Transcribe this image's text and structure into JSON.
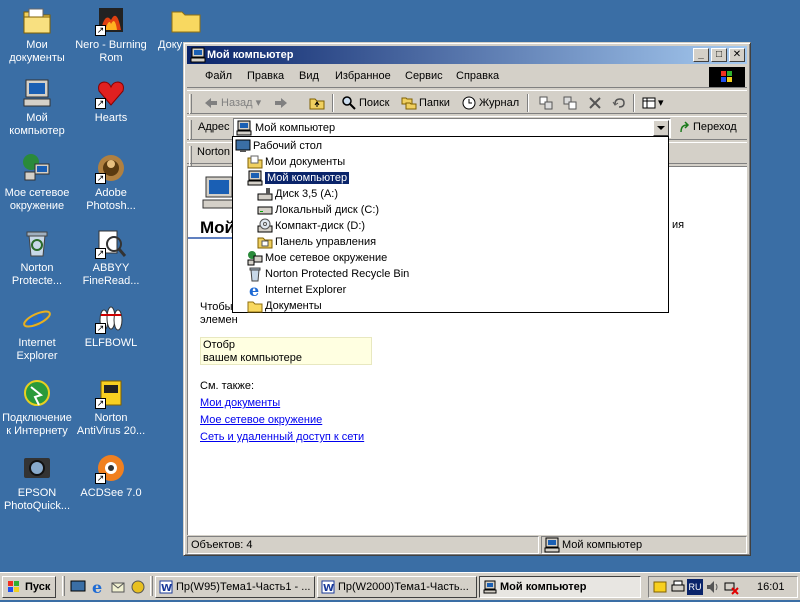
{
  "desktop": {
    "icons": [
      {
        "label": "Мои документы",
        "icon": "my-documents-icon"
      },
      {
        "label": "Nero - Burning Rom",
        "icon": "nero-icon"
      },
      {
        "label": "Доку",
        "icon": "folder-icon"
      },
      {
        "label": "Мой компьютер",
        "icon": "my-computer-icon"
      },
      {
        "label": "Hearts",
        "icon": "hearts-icon"
      },
      {
        "label": "Мое сетевое окружение",
        "icon": "network-icon"
      },
      {
        "label": "Adobe Photosh...",
        "icon": "photoshop-icon"
      },
      {
        "label": "Norton Protecte...",
        "icon": "recycle-bin-icon"
      },
      {
        "label": "ABBYY FineRead...",
        "icon": "abbyy-icon"
      },
      {
        "label": "Internet Explorer",
        "icon": "ie-icon"
      },
      {
        "label": "ELFBOWL",
        "icon": "elfbowl-icon"
      },
      {
        "label": "Подключение к Интернету",
        "icon": "connect-icon"
      },
      {
        "label": "Norton AntiVirus 20...",
        "icon": "norton-icon"
      },
      {
        "label": "EPSON PhotoQuick...",
        "icon": "epson-icon"
      },
      {
        "label": "ACDSee 7.0",
        "icon": "acdsee-icon"
      }
    ]
  },
  "window": {
    "title": "Мой компьютер",
    "menu": [
      "Файл",
      "Правка",
      "Вид",
      "Избранное",
      "Сервис",
      "Справка"
    ],
    "toolbar": {
      "back": "Назад",
      "search": "Поиск",
      "folders": "Папки",
      "history": "Журнал"
    },
    "address": {
      "label": "Адрес",
      "value": "Мой компьютер",
      "go": "Переход"
    },
    "links": {
      "item": "Norton"
    },
    "content": {
      "heading": "Мой",
      "side_text": "ия",
      "intro1": "Чтобы",
      "intro2": "элемен",
      "tooltip1": "Отобр",
      "tooltip2": "вашем компьютере",
      "see_also": "См. также:",
      "links": [
        "Мои документы",
        "Мое сетевое окружение",
        "Сеть и удаленный доступ к сети"
      ]
    },
    "status": {
      "objects": "Объектов: 4",
      "location": "Мой компьютер"
    },
    "dropdown": [
      {
        "label": "Рабочий стол",
        "icon": "desktop-icon",
        "level": 0
      },
      {
        "label": "Мои документы",
        "icon": "my-documents-icon",
        "level": 1
      },
      {
        "label": "Мой компьютер",
        "icon": "my-computer-icon",
        "level": 1,
        "selected": true
      },
      {
        "label": "Диск 3,5 (A:)",
        "icon": "floppy-icon",
        "level": 2
      },
      {
        "label": "Локальный диск (C:)",
        "icon": "hard-drive-icon",
        "level": 2
      },
      {
        "label": "Компакт-диск (D:)",
        "icon": "cd-drive-icon",
        "level": 2
      },
      {
        "label": "Панель управления",
        "icon": "control-panel-icon",
        "level": 2
      },
      {
        "label": "Мое сетевое окружение",
        "icon": "network-icon",
        "level": 1
      },
      {
        "label": "Norton Protected Recycle Bin",
        "icon": "recycle-bin-icon",
        "level": 1
      },
      {
        "label": "Internet Explorer",
        "icon": "ie-icon",
        "level": 1
      },
      {
        "label": "Документы",
        "icon": "folder-icon",
        "level": 1
      }
    ]
  },
  "taskbar": {
    "start": "Пуск",
    "tasks": [
      {
        "label": "Пр(W95)Тема1-Часть1 - ...",
        "active": false
      },
      {
        "label": "Пр(W2000)Тема1-Часть...",
        "active": false
      },
      {
        "label": "Мой компьютер",
        "active": true
      }
    ],
    "language": "RU",
    "clock": "16:01"
  }
}
